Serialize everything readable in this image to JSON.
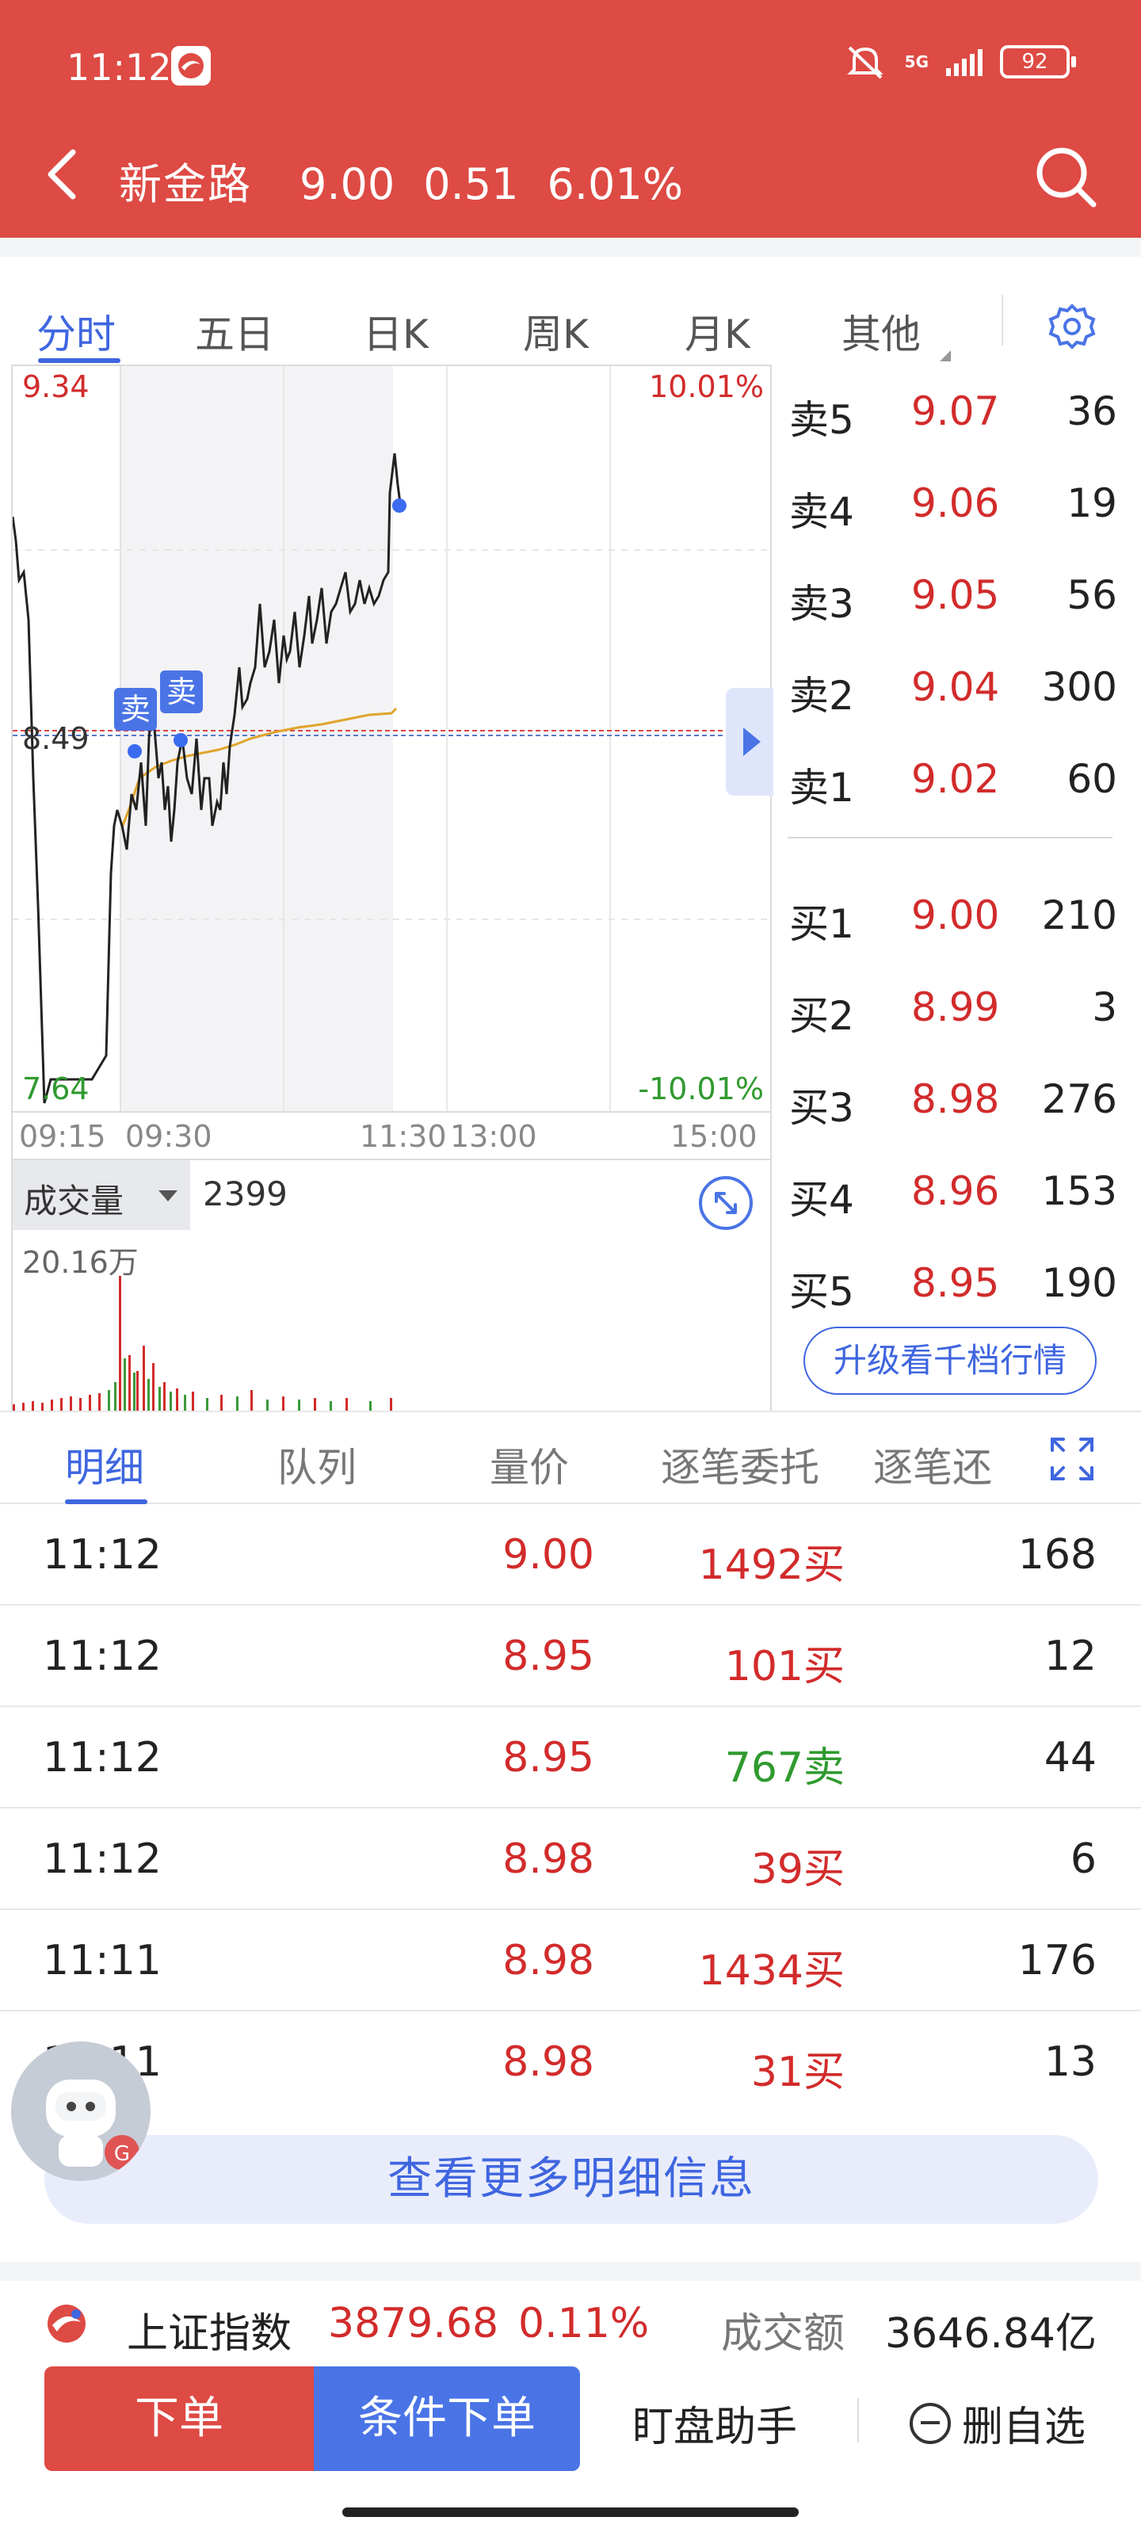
{
  "status_bar": {
    "time": "11:12",
    "network": "5G",
    "battery": "92"
  },
  "header": {
    "stock_name": "新金路",
    "price": "9.00",
    "change": "0.51",
    "change_pct": "6.01%"
  },
  "chart_tabs": [
    "分时",
    "五日",
    "日K",
    "周K",
    "月K",
    "其他"
  ],
  "chart": {
    "top_price": "9.34",
    "top_pct": "10.01%",
    "mid_price": "8.49",
    "bottom_price": "7.64",
    "bottom_pct": "-10.01%",
    "time_labels": [
      "09:15",
      "09:30",
      "11:30",
      "13:00",
      "15:00"
    ],
    "sell_tags": [
      "卖",
      "卖"
    ]
  },
  "volume": {
    "selector_label": "成交量",
    "value": "2399",
    "max_label": "20.16万"
  },
  "order_book": {
    "asks": [
      {
        "label": "卖5",
        "price": "9.07",
        "volume": "36"
      },
      {
        "label": "卖4",
        "price": "9.06",
        "volume": "19"
      },
      {
        "label": "卖3",
        "price": "9.05",
        "volume": "56"
      },
      {
        "label": "卖2",
        "price": "9.04",
        "volume": "300"
      },
      {
        "label": "卖1",
        "price": "9.02",
        "volume": "60"
      }
    ],
    "bids": [
      {
        "label": "买1",
        "price": "9.00",
        "volume": "210"
      },
      {
        "label": "买2",
        "price": "8.99",
        "volume": "3"
      },
      {
        "label": "买3",
        "price": "8.98",
        "volume": "276"
      },
      {
        "label": "买4",
        "price": "8.96",
        "volume": "153"
      },
      {
        "label": "买5",
        "price": "8.95",
        "volume": "190"
      }
    ],
    "upgrade_label": "升级看千档行情"
  },
  "detail_tabs": [
    "明细",
    "队列",
    "量价",
    "逐笔委托",
    "逐笔还"
  ],
  "trades": [
    {
      "time": "11:12",
      "price": "9.00",
      "volume": "1492买",
      "side": "buy",
      "count": "168"
    },
    {
      "time": "11:12",
      "price": "8.95",
      "volume": "101买",
      "side": "buy",
      "count": "12"
    },
    {
      "time": "11:12",
      "price": "8.95",
      "volume": "767卖",
      "side": "sell",
      "count": "44"
    },
    {
      "time": "11:12",
      "price": "8.98",
      "volume": "39买",
      "side": "buy",
      "count": "6"
    },
    {
      "time": "11:11",
      "price": "8.98",
      "volume": "1434买",
      "side": "buy",
      "count": "176"
    },
    {
      "time": "11:11",
      "price": "8.98",
      "volume": "31买",
      "side": "buy",
      "count": "13"
    }
  ],
  "more_detail_label": "查看更多明细信息",
  "index_bar": {
    "name": "上证指数",
    "value": "3879.68",
    "pct": "0.11%",
    "amount_label": "成交额",
    "amount_value": "3646.84亿"
  },
  "actions": {
    "order": "下单",
    "conditional_order": "条件下单",
    "watch_assistant": "盯盘助手",
    "remove_watchlist": "删自选"
  },
  "colors": {
    "brand_red": "#de4a44",
    "accent_blue": "#3f66e0",
    "up_red": "#d22b2b",
    "down_green": "#2f9a2f"
  }
}
